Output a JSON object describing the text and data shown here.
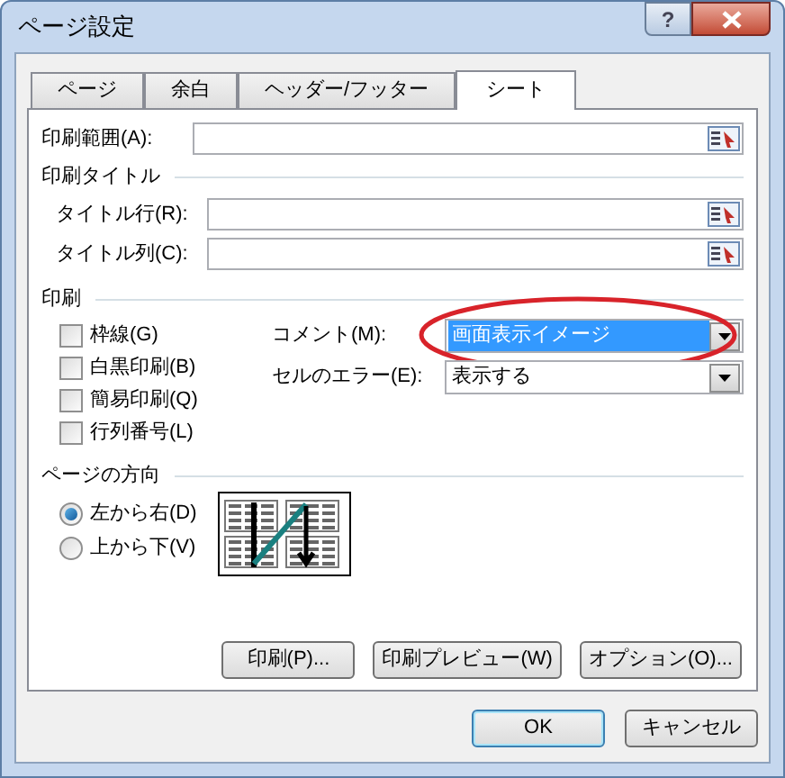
{
  "window": {
    "title": "ページ設定",
    "help": "?"
  },
  "tabs": [
    {
      "label": "ページ",
      "selected": false
    },
    {
      "label": "余白",
      "selected": false
    },
    {
      "label": "ヘッダー/フッター",
      "selected": false
    },
    {
      "label": "シート",
      "selected": true
    }
  ],
  "print_area": {
    "label": "印刷範囲(A):"
  },
  "print_titles": {
    "heading": "印刷タイトル",
    "rows": [
      {
        "label": "タイトル行(R):"
      },
      {
        "label": "タイトル列(C):"
      }
    ]
  },
  "print": {
    "heading": "印刷",
    "checkboxes": [
      {
        "label": "枠線(G)",
        "checked": false
      },
      {
        "label": "白黒印刷(B)",
        "checked": false
      },
      {
        "label": "簡易印刷(Q)",
        "checked": false
      },
      {
        "label": "行列番号(L)",
        "checked": false
      }
    ],
    "selects": [
      {
        "label": "コメント(M):",
        "value": "画面表示イメージ",
        "text_selected": true,
        "circled": true
      },
      {
        "label": "セルのエラー(E):",
        "value": "表示する",
        "text_selected": false,
        "circled": false
      }
    ]
  },
  "page_order": {
    "heading": "ページの方向",
    "radios": [
      {
        "label": "左から右(D)",
        "selected": true
      },
      {
        "label": "上から下(V)",
        "selected": false
      }
    ]
  },
  "panel_buttons": [
    "印刷(P)...",
    "印刷プレビュー(W)",
    "オプション(O)..."
  ],
  "footer_buttons": [
    {
      "label": "OK",
      "focused": true
    },
    {
      "label": "キャンセル",
      "focused": false
    }
  ]
}
